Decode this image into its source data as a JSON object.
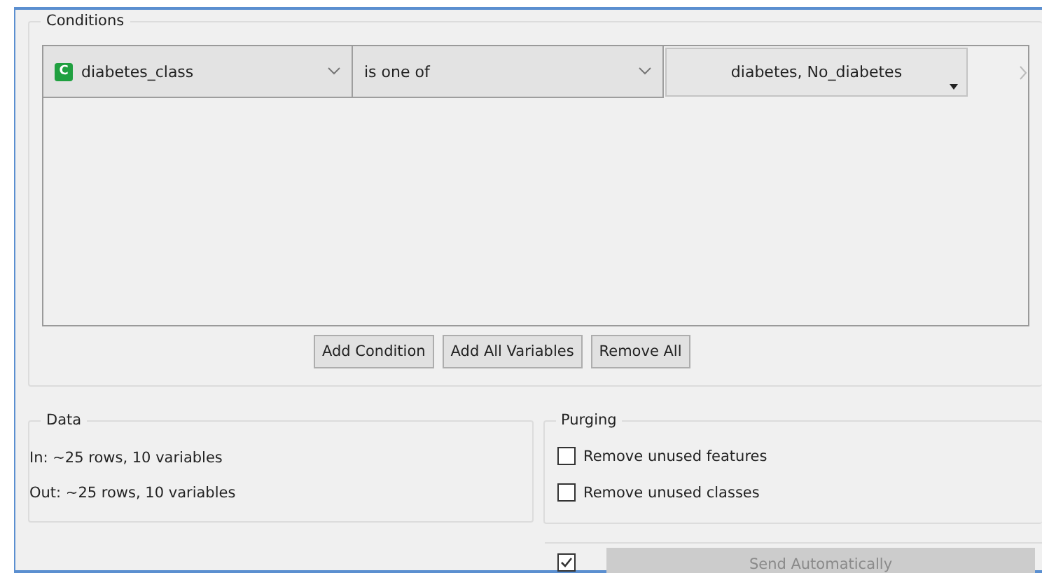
{
  "conditions": {
    "title": "Conditions",
    "rows": [
      {
        "variable": "diabetes_class",
        "variable_type": "C",
        "operator": "is one of",
        "value": "diabetes, No_diabetes"
      }
    ],
    "buttons": [
      "Add Condition",
      "Add All Variables",
      "Remove All"
    ]
  },
  "data": {
    "title": "Data",
    "lines": [
      "In: ~25 rows, 10 variables",
      "Out: ~25 rows, 10 variables"
    ]
  },
  "purging": {
    "title": "Purging",
    "options": [
      {
        "label": "Remove unused features",
        "checked": false
      },
      {
        "label": "Remove unused classes",
        "checked": false
      }
    ]
  },
  "send": {
    "auto_checked": true,
    "label": "Send Automatically",
    "disabled": true
  }
}
